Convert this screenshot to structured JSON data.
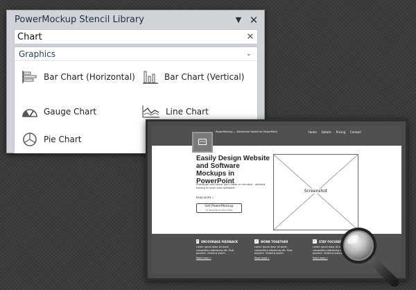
{
  "panel": {
    "title": "PowerMockup Stencil Library",
    "dropdown_icon": "triangle-down-icon",
    "close_icon": "close-icon",
    "search": {
      "value": "Chart",
      "clear_icon": "clear-x-icon"
    },
    "group": {
      "label": "Graphics",
      "expanded": true
    },
    "items": [
      {
        "label": "Bar Chart (Horizontal)",
        "icon": "bar-chart-horizontal-icon"
      },
      {
        "label": "Bar Chart (Vertical)",
        "icon": "bar-chart-vertical-icon"
      },
      {
        "label": "Gauge Chart",
        "icon": "gauge-chart-icon"
      },
      {
        "label": "Line Chart",
        "icon": "line-chart-icon"
      },
      {
        "label": "Pie Chart",
        "icon": "pie-chart-icon"
      }
    ]
  },
  "mockup": {
    "logo_text": "LOGO",
    "tagline": "PowerMockup — Wireframe Toolkit for PowerPoint",
    "menu": [
      "Home",
      "Details",
      "Pricing",
      "Contact"
    ],
    "headline": "Easily Design Website and Software Mockups in PowerPoint",
    "subtext": "Prototype and share your ideas in minutes – without having to learn new software.",
    "read_more": "READ MORE »",
    "cta": {
      "label": "Get PowerMockup",
      "sublabel": "for PowerPoint 2007-2016"
    },
    "screenshot_label": "Screenshot",
    "features": [
      {
        "title": "ENCOURAGE FEEDBACK",
        "text": "Lorem ipsum dolor sit amet, consectetur adipiscing elit. Duis posuere. Vivamus ipsum.",
        "link": "Read more »"
      },
      {
        "title": "WORK TOGETHER",
        "text": "Lorem ipsum dolor sit amet, consectetur adipiscing elit. Duis posuere. Vivamus ipsum.",
        "link": "Read more »"
      },
      {
        "title": "STAY FOCUSED",
        "text": "Lorem ipsum dolor sit amet, consectetur adipiscing elit. Duis posuere. Vivamus ipsum.",
        "link": "Read more »"
      }
    ]
  }
}
